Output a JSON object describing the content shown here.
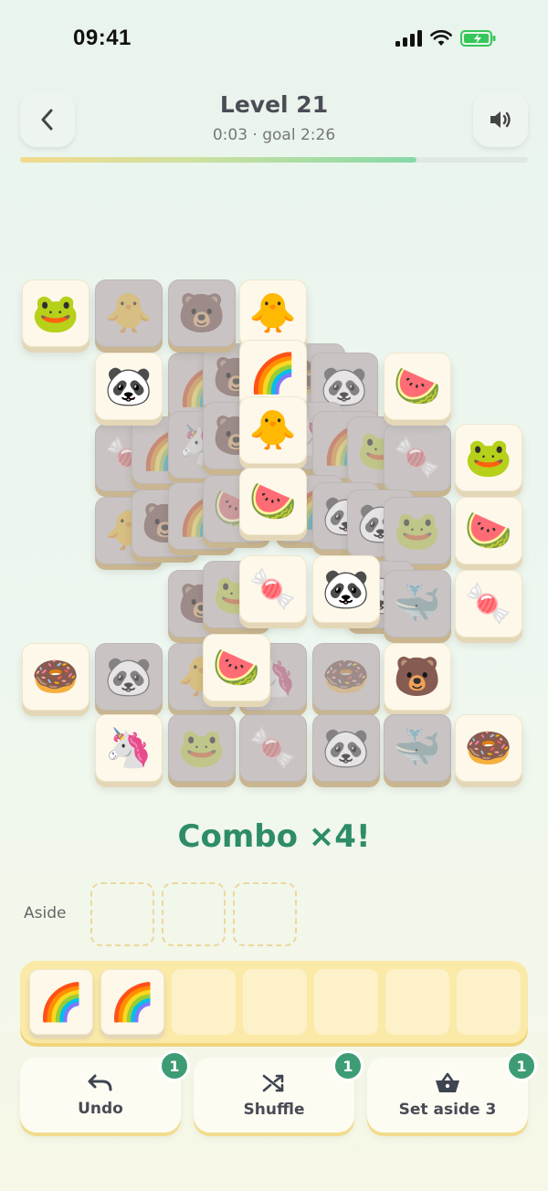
{
  "status": {
    "time": "09:41"
  },
  "header": {
    "level_title": "Level 21",
    "subtitle": "0:03 · goal 2:26",
    "progress": 0.78,
    "back_icon": "chevron-left-icon",
    "sound_icon": "speaker-icon"
  },
  "board": {
    "tiles": [
      {
        "id": "b1",
        "emoji": "🌈",
        "blocked": true
      },
      {
        "id": "b2",
        "emoji": "🐻",
        "blocked": true
      },
      {
        "id": "b3",
        "emoji": "🍩",
        "blocked": true
      },
      {
        "id": "b4",
        "emoji": "🐼",
        "blocked": true
      },
      {
        "id": "b5",
        "emoji": "🍬",
        "blocked": true
      },
      {
        "id": "b6",
        "emoji": "🌈",
        "blocked": true
      },
      {
        "id": "b7",
        "emoji": "🦄",
        "blocked": true
      },
      {
        "id": "b8",
        "emoji": "🐻",
        "blocked": true
      },
      {
        "id": "b9",
        "emoji": "🦄",
        "blocked": true
      },
      {
        "id": "b10",
        "emoji": "🌈",
        "blocked": true
      },
      {
        "id": "b11",
        "emoji": "🐸",
        "blocked": true
      },
      {
        "id": "b12",
        "emoji": "🍬",
        "blocked": true
      },
      {
        "id": "b13",
        "emoji": "🐥",
        "blocked": true
      },
      {
        "id": "b14",
        "emoji": "🐻",
        "blocked": true
      },
      {
        "id": "b15",
        "emoji": "🌈",
        "blocked": true
      },
      {
        "id": "b16",
        "emoji": "🍉",
        "blocked": true
      },
      {
        "id": "b17",
        "emoji": "🌈",
        "blocked": true
      },
      {
        "id": "b18",
        "emoji": "🐼",
        "blocked": true
      },
      {
        "id": "b19",
        "emoji": "🐼",
        "blocked": true
      },
      {
        "id": "b20",
        "emoji": "🐸",
        "blocked": true
      },
      {
        "id": "b21",
        "emoji": "🐻",
        "blocked": true
      },
      {
        "id": "b22",
        "emoji": "🐸",
        "blocked": true
      },
      {
        "id": "b23",
        "emoji": "🐼",
        "blocked": true
      },
      {
        "id": "b24",
        "emoji": "🐳",
        "blocked": true
      },
      {
        "id": "b25",
        "emoji": "🐥",
        "blocked": true
      },
      {
        "id": "b26",
        "emoji": "🦄",
        "blocked": true
      },
      {
        "id": "r1_1",
        "emoji": "🐸",
        "blocked": false
      },
      {
        "id": "r1_2",
        "emoji": "🐥",
        "blocked": true
      },
      {
        "id": "r1_3",
        "emoji": "🐻",
        "blocked": true
      },
      {
        "id": "r1_4",
        "emoji": "🐥",
        "blocked": false
      },
      {
        "id": "r2_1",
        "emoji": "🐼",
        "blocked": false
      },
      {
        "id": "r2_2",
        "emoji": "🍉",
        "blocked": false
      },
      {
        "id": "r3_1",
        "emoji": "🐸",
        "blocked": false
      },
      {
        "id": "r4_1",
        "emoji": "🍉",
        "blocked": false
      },
      {
        "id": "r5_1",
        "emoji": "🍬",
        "blocked": false
      },
      {
        "id": "r6_1",
        "emoji": "🍩",
        "blocked": false
      },
      {
        "id": "r6_2",
        "emoji": "🐼",
        "blocked": true
      },
      {
        "id": "r6_3",
        "emoji": "🍩",
        "blocked": true
      },
      {
        "id": "r6_4",
        "emoji": "🐻",
        "blocked": false
      },
      {
        "id": "r7_1",
        "emoji": "🦄",
        "blocked": false
      },
      {
        "id": "r7_2",
        "emoji": "🐸",
        "blocked": true
      },
      {
        "id": "r7_3",
        "emoji": "🍬",
        "blocked": true
      },
      {
        "id": "r7_4",
        "emoji": "🐼",
        "blocked": true
      },
      {
        "id": "r7_5",
        "emoji": "🐳",
        "blocked": true
      },
      {
        "id": "r7_6",
        "emoji": "🍩",
        "blocked": false
      },
      {
        "id": "c1",
        "emoji": "🌈",
        "blocked": false
      },
      {
        "id": "c2",
        "emoji": "🐥",
        "blocked": false
      },
      {
        "id": "c3",
        "emoji": "🍉",
        "blocked": false
      },
      {
        "id": "c4",
        "emoji": "🍬",
        "blocked": false
      },
      {
        "id": "c5",
        "emoji": "🐼",
        "blocked": false
      },
      {
        "id": "c6",
        "emoji": "🍉",
        "blocked": false
      }
    ]
  },
  "combo_text": "Combo ×4!",
  "aside": {
    "label": "Aside",
    "slots": 3
  },
  "tray": {
    "slots": [
      "🌈",
      "🌈",
      "",
      "",
      "",
      "",
      ""
    ]
  },
  "actions": [
    {
      "label": "Undo",
      "icon": "undo-icon",
      "badge": "1"
    },
    {
      "label": "Shuffle",
      "icon": "shuffle-icon",
      "badge": "1"
    },
    {
      "label": "Set aside 3",
      "icon": "basket-icon",
      "badge": "1"
    }
  ],
  "colors": {
    "accent": "#3e9c74",
    "combo": "#2e8c68",
    "tray": "#fbe9a8"
  }
}
